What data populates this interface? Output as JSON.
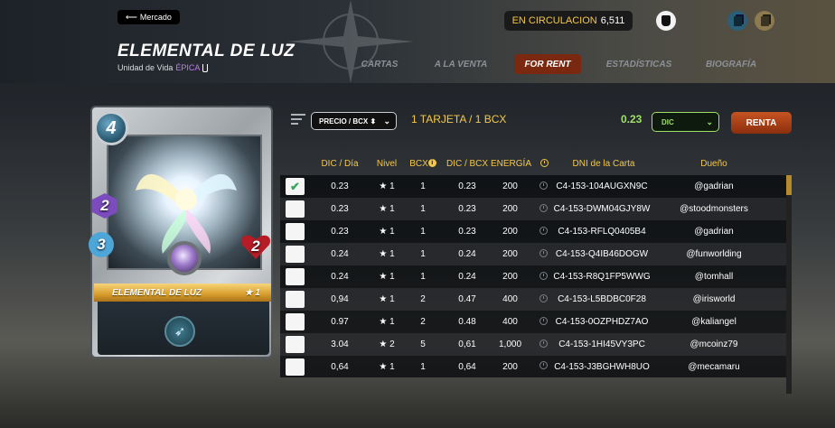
{
  "header": {
    "back_label": "Mercado",
    "circulation_label": "EN CIRCULACION",
    "circulation_value": "6,511",
    "title": "ELEMENTAL DE LUZ",
    "subtitle_prefix": "Unidad de Vida",
    "rarity": "ÉPICA",
    "nav": [
      {
        "label": "CARTAS",
        "active": false
      },
      {
        "label": "A LA VENTA",
        "active": false
      },
      {
        "label": "FOR RENT",
        "active": true
      },
      {
        "label": "ESTADÍSTICAS",
        "active": false
      },
      {
        "label": "BIOGRAFÍA",
        "active": false
      }
    ]
  },
  "card": {
    "mana": "4",
    "magic": "2",
    "speed": "3",
    "health": "2",
    "name": "ELEMENTAL DE LUZ",
    "level": "★ 1"
  },
  "controls": {
    "sort_label": "PRECIO / BCX ⬍",
    "count_label": "1 TARJETA / 1 BCX",
    "price": "0.23",
    "currency": "DIC",
    "rent_label": "RENTA"
  },
  "table": {
    "headers": [
      "DIC / Día",
      "Nivel",
      "BCX",
      "DIC / BCX",
      "ENERGÍA",
      "DNI de la Carta",
      "Dueño"
    ],
    "rows": [
      {
        "checked": true,
        "dic": "0.23",
        "lvl": "★ 1",
        "bcx": "1",
        "dbcx": "0.23",
        "en": "200",
        "uid": "C4-153-104AUGXN9C",
        "owner": "@gadrian"
      },
      {
        "checked": false,
        "dic": "0.23",
        "lvl": "★ 1",
        "bcx": "1",
        "dbcx": "0.23",
        "en": "200",
        "uid": "C4-153-DWM04GJY8W",
        "owner": "@stoodmonsters"
      },
      {
        "checked": false,
        "dic": "0.23",
        "lvl": "★ 1",
        "bcx": "1",
        "dbcx": "0.23",
        "en": "200",
        "uid": "C4-153-RFLQ0405B4",
        "owner": "@gadrian"
      },
      {
        "checked": false,
        "dic": "0.24",
        "lvl": "★ 1",
        "bcx": "1",
        "dbcx": "0.24",
        "en": "200",
        "uid": "C4-153-Q4IB46DOGW",
        "owner": "@funworlding"
      },
      {
        "checked": false,
        "dic": "0.24",
        "lvl": "★ 1",
        "bcx": "1",
        "dbcx": "0.24",
        "en": "200",
        "uid": "C4-153-R8Q1FP5WWG",
        "owner": "@tomhall"
      },
      {
        "checked": false,
        "dic": "0,94",
        "lvl": "★ 1",
        "bcx": "2",
        "dbcx": "0.47",
        "en": "400",
        "uid": "C4-153-L5BDBC0F28",
        "owner": "@irisworld"
      },
      {
        "checked": false,
        "dic": "0.97",
        "lvl": "★ 1",
        "bcx": "2",
        "dbcx": "0.48",
        "en": "400",
        "uid": "C4-153-0OZPHDZ7AO",
        "owner": "@kaliangel"
      },
      {
        "checked": false,
        "dic": "3.04",
        "lvl": "★ 2",
        "bcx": "5",
        "dbcx": "0,61",
        "en": "1,000",
        "uid": "C4-153-1HI45VY3PC",
        "owner": "@mcoinz79"
      },
      {
        "checked": false,
        "dic": "0,64",
        "lvl": "★ 1",
        "bcx": "1",
        "dbcx": "0,64",
        "en": "200",
        "uid": "C4-153-J3BGHWH8UO",
        "owner": "@mecamaru"
      }
    ]
  }
}
